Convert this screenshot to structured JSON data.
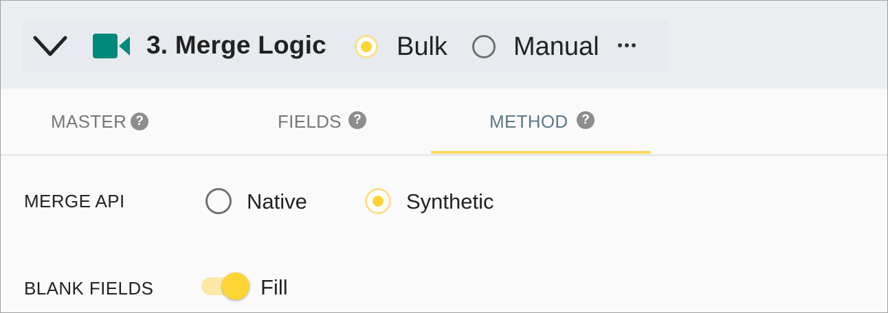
{
  "header": {
    "expand_icon": "chevron-down-icon",
    "step_icon": "video-camera-icon",
    "step_icon_color": "#00897b",
    "title": "3. Merge Logic",
    "mode_options": [
      {
        "label": "Bulk",
        "selected": true
      },
      {
        "label": "Manual",
        "selected": false
      }
    ],
    "more_icon": "more-horizontal-icon"
  },
  "tabs": [
    {
      "label": "MASTER",
      "help": "?",
      "active": false
    },
    {
      "label": "FIELDS",
      "help": "?",
      "active": false
    },
    {
      "label": "METHOD",
      "help": "?",
      "active": true
    }
  ],
  "method": {
    "merge_api": {
      "label": "MERGE API",
      "options": [
        {
          "label": "Native",
          "selected": false
        },
        {
          "label": "Synthetic",
          "selected": true
        }
      ]
    },
    "blank_fields": {
      "label": "BLANK FIELDS",
      "toggle_label": "Fill",
      "on": true
    }
  },
  "colors": {
    "accent": "#fcd535",
    "header_bg": "#eceff2",
    "active_tab_text": "#5d7784"
  }
}
